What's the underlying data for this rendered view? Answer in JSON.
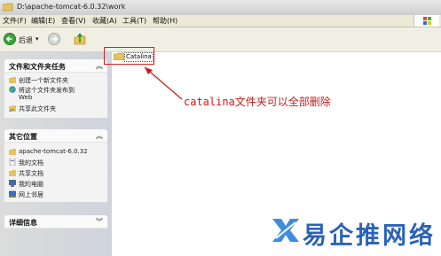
{
  "window": {
    "title": "D:\\apache-tomcat-6.0.32\\work"
  },
  "menu": [
    "文件(F)",
    "编辑(E)",
    "查看(V)",
    "收藏(A)",
    "工具(T)",
    "帮助(H)"
  ],
  "toolbar": {
    "back_label": "后退",
    "back_arrow": "▾"
  },
  "sidebar": {
    "file_tasks": {
      "title": "文件和文件夹任务",
      "items": [
        "创建一个新文件夹",
        "将这个文件夹发布到",
        "Web",
        "共享此文件夹"
      ]
    },
    "other_places": {
      "title": "其它位置",
      "items": [
        "apache-tomcat-6.0.32",
        "我的文档",
        "共享文档",
        "我的电脑",
        "网上邻居"
      ]
    },
    "details": {
      "title": "详细信息"
    },
    "chevron_up": "︽",
    "chevron_down": "︾"
  },
  "content": {
    "folder_name": "Catalina",
    "annotation": "catalina文件夹可以全部删除"
  },
  "watermark": {
    "text": "易企推网络"
  }
}
